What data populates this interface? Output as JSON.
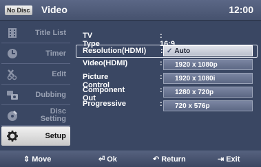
{
  "header": {
    "badge": "No Disc",
    "title": "Video",
    "clock": "12:00"
  },
  "sidebar": {
    "items": [
      {
        "label": "Title List",
        "icon": "title-list-icon"
      },
      {
        "label": "Timer",
        "icon": "timer-icon"
      },
      {
        "label": "Edit",
        "icon": "edit-icon"
      },
      {
        "label": "Dubbing",
        "icon": "dubbing-icon"
      },
      {
        "label": "Disc Setting",
        "label_line1": "Disc",
        "label_line2": "Setting",
        "icon": "disc-setting-icon"
      },
      {
        "label": "Setup",
        "icon": "setup-icon",
        "active": true
      }
    ]
  },
  "settings": {
    "rows": [
      {
        "key": "TV Type",
        "value": ": 16:9"
      },
      {
        "key": "Resolution(HDMI)",
        "value": ":",
        "highlighted": true
      },
      {
        "key": "Video(HDMI)",
        "value": ":"
      },
      {
        "key": "Picture Control",
        "value": ":"
      },
      {
        "key": "Component Out",
        "value": ":"
      },
      {
        "key": "Progressive",
        "value": ":"
      }
    ]
  },
  "dropdown": {
    "options": [
      {
        "label": "Auto",
        "selected": true
      },
      {
        "label": "1920 x 1080p"
      },
      {
        "label": "1920 x 1080i"
      },
      {
        "label": "1280 x 720p"
      },
      {
        "label": "720 x 576p"
      }
    ]
  },
  "footer": {
    "move": "Move",
    "ok": "Ok",
    "return": "Return",
    "exit": "Exit"
  }
}
